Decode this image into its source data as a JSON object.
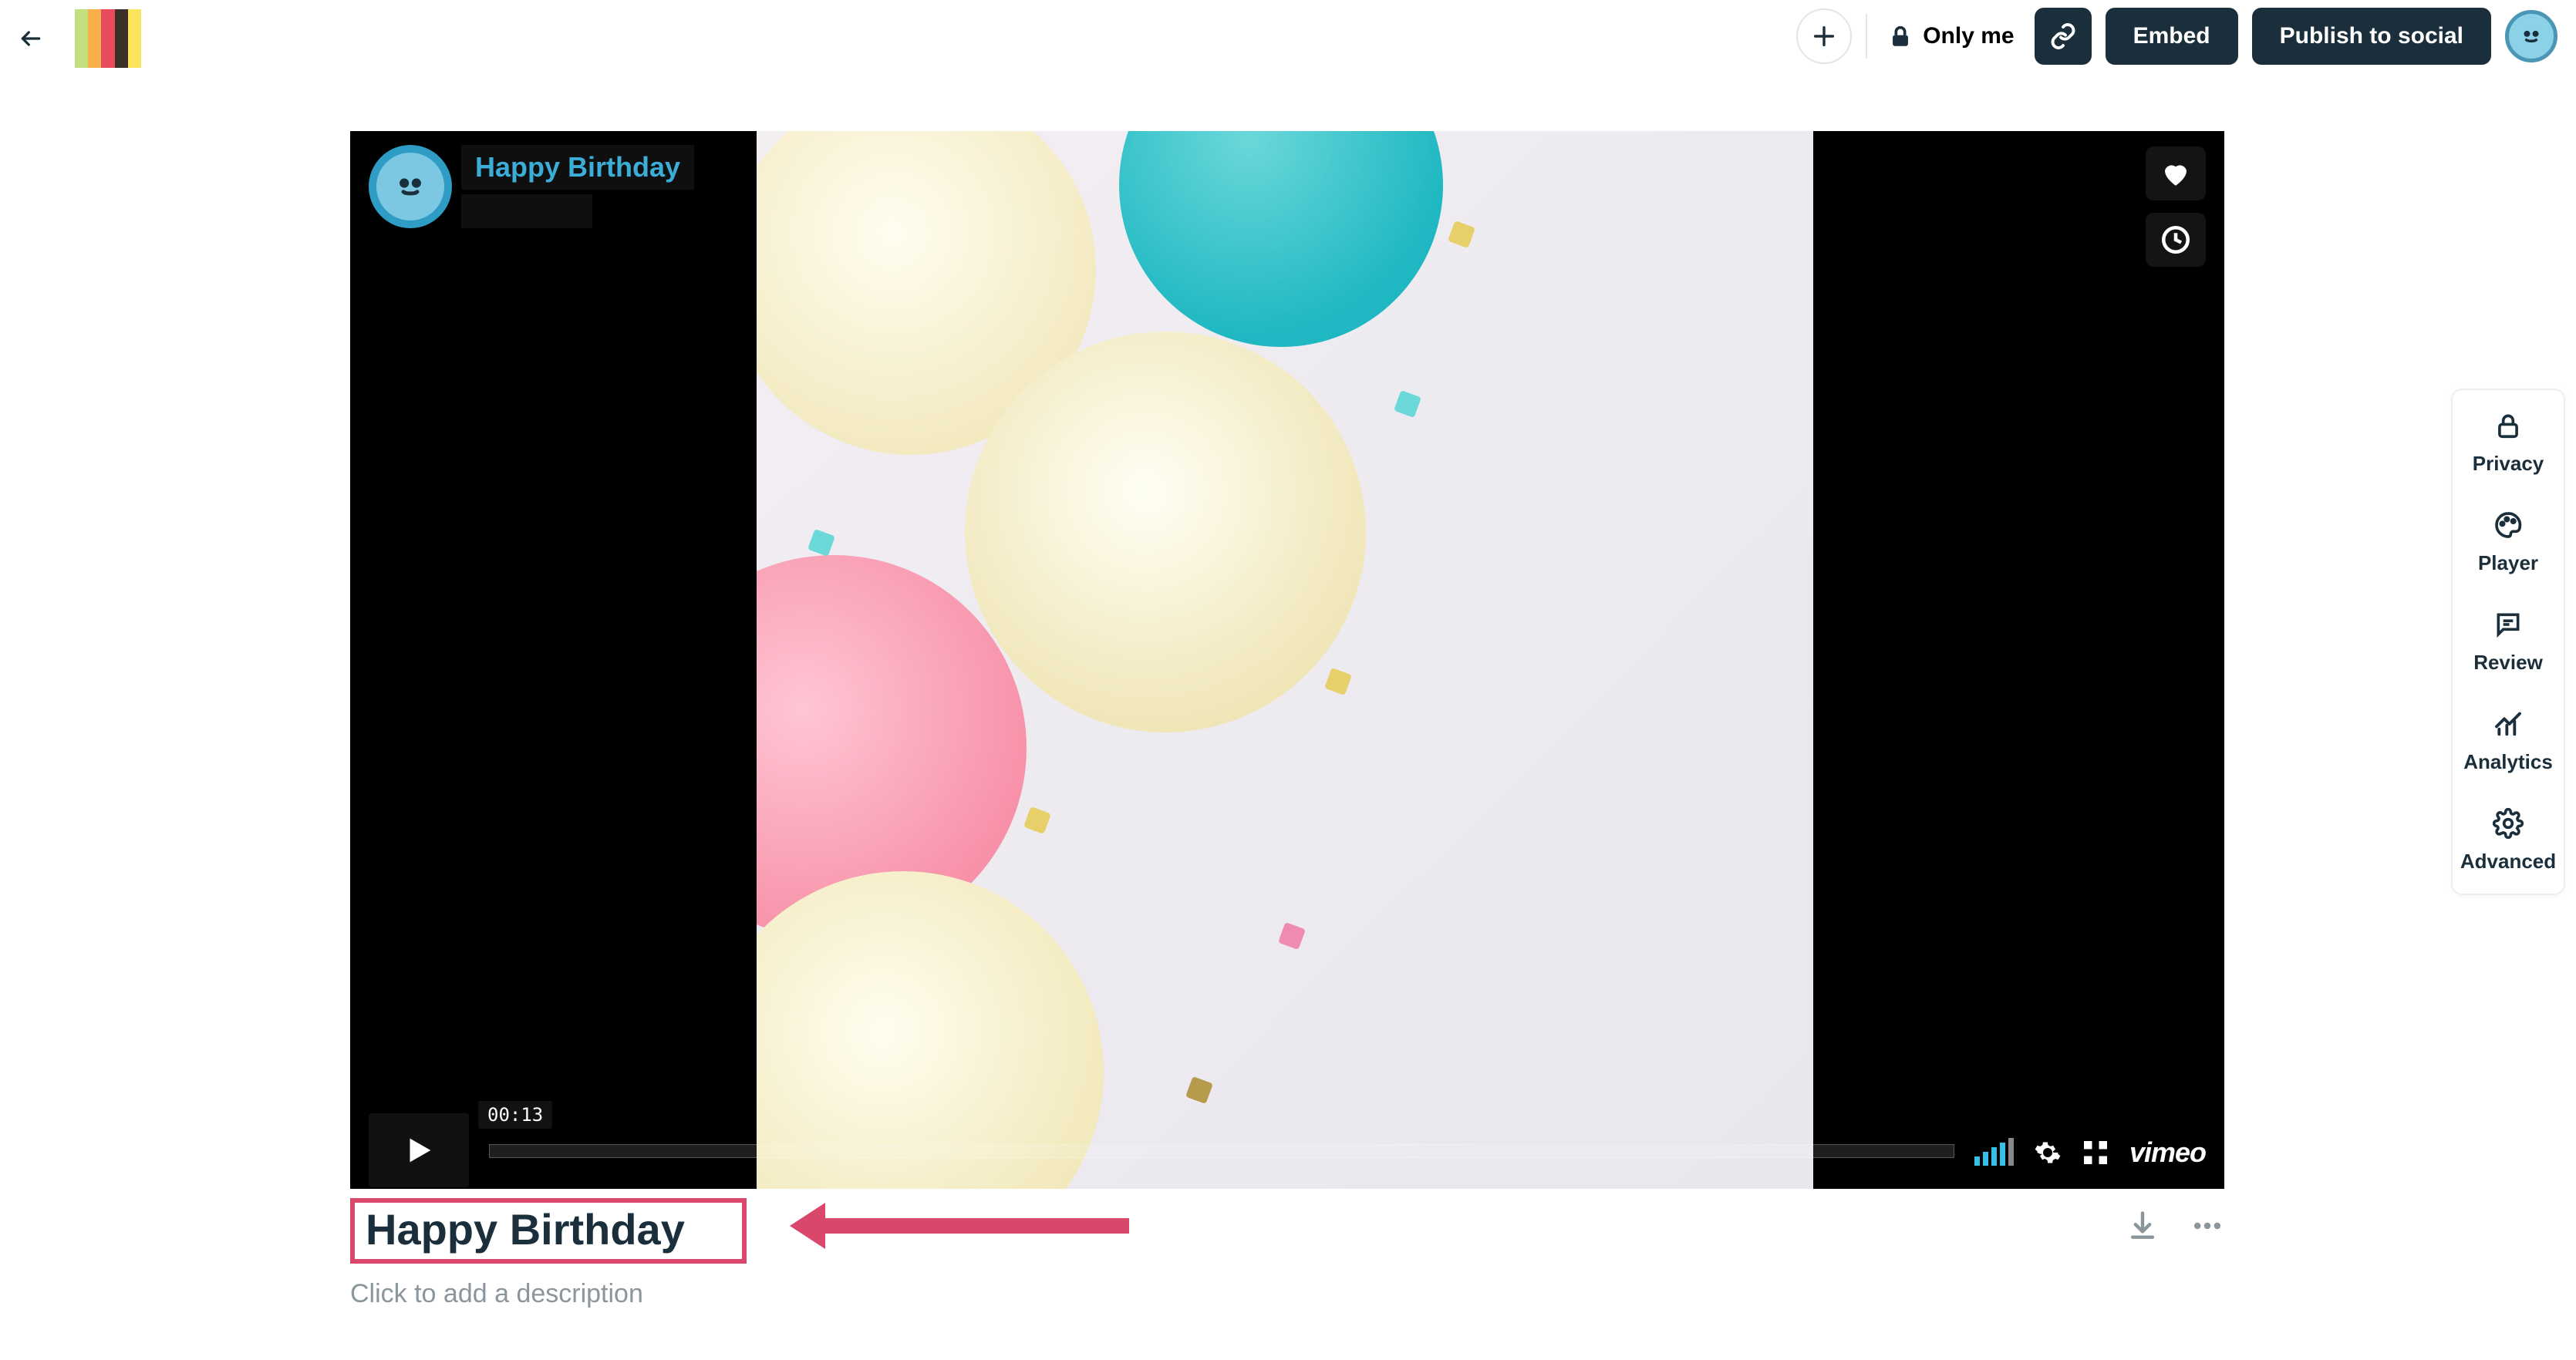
{
  "header": {
    "privacy_label": "Only me",
    "embed_label": "Embed",
    "publish_label": "Publish to social"
  },
  "player": {
    "overlay_title": "Happy Birthday",
    "timecode": "00:13",
    "watermark": "vimeo"
  },
  "title": {
    "value": "Happy Birthday",
    "description_placeholder": "Click to add a description"
  },
  "sidebar": {
    "items": [
      {
        "label": "Privacy",
        "icon": "lock-icon"
      },
      {
        "label": "Player",
        "icon": "palette-icon"
      },
      {
        "label": "Review",
        "icon": "chat-icon"
      },
      {
        "label": "Analytics",
        "icon": "trend-icon"
      },
      {
        "label": "Advanced",
        "icon": "gear-icon"
      }
    ]
  }
}
